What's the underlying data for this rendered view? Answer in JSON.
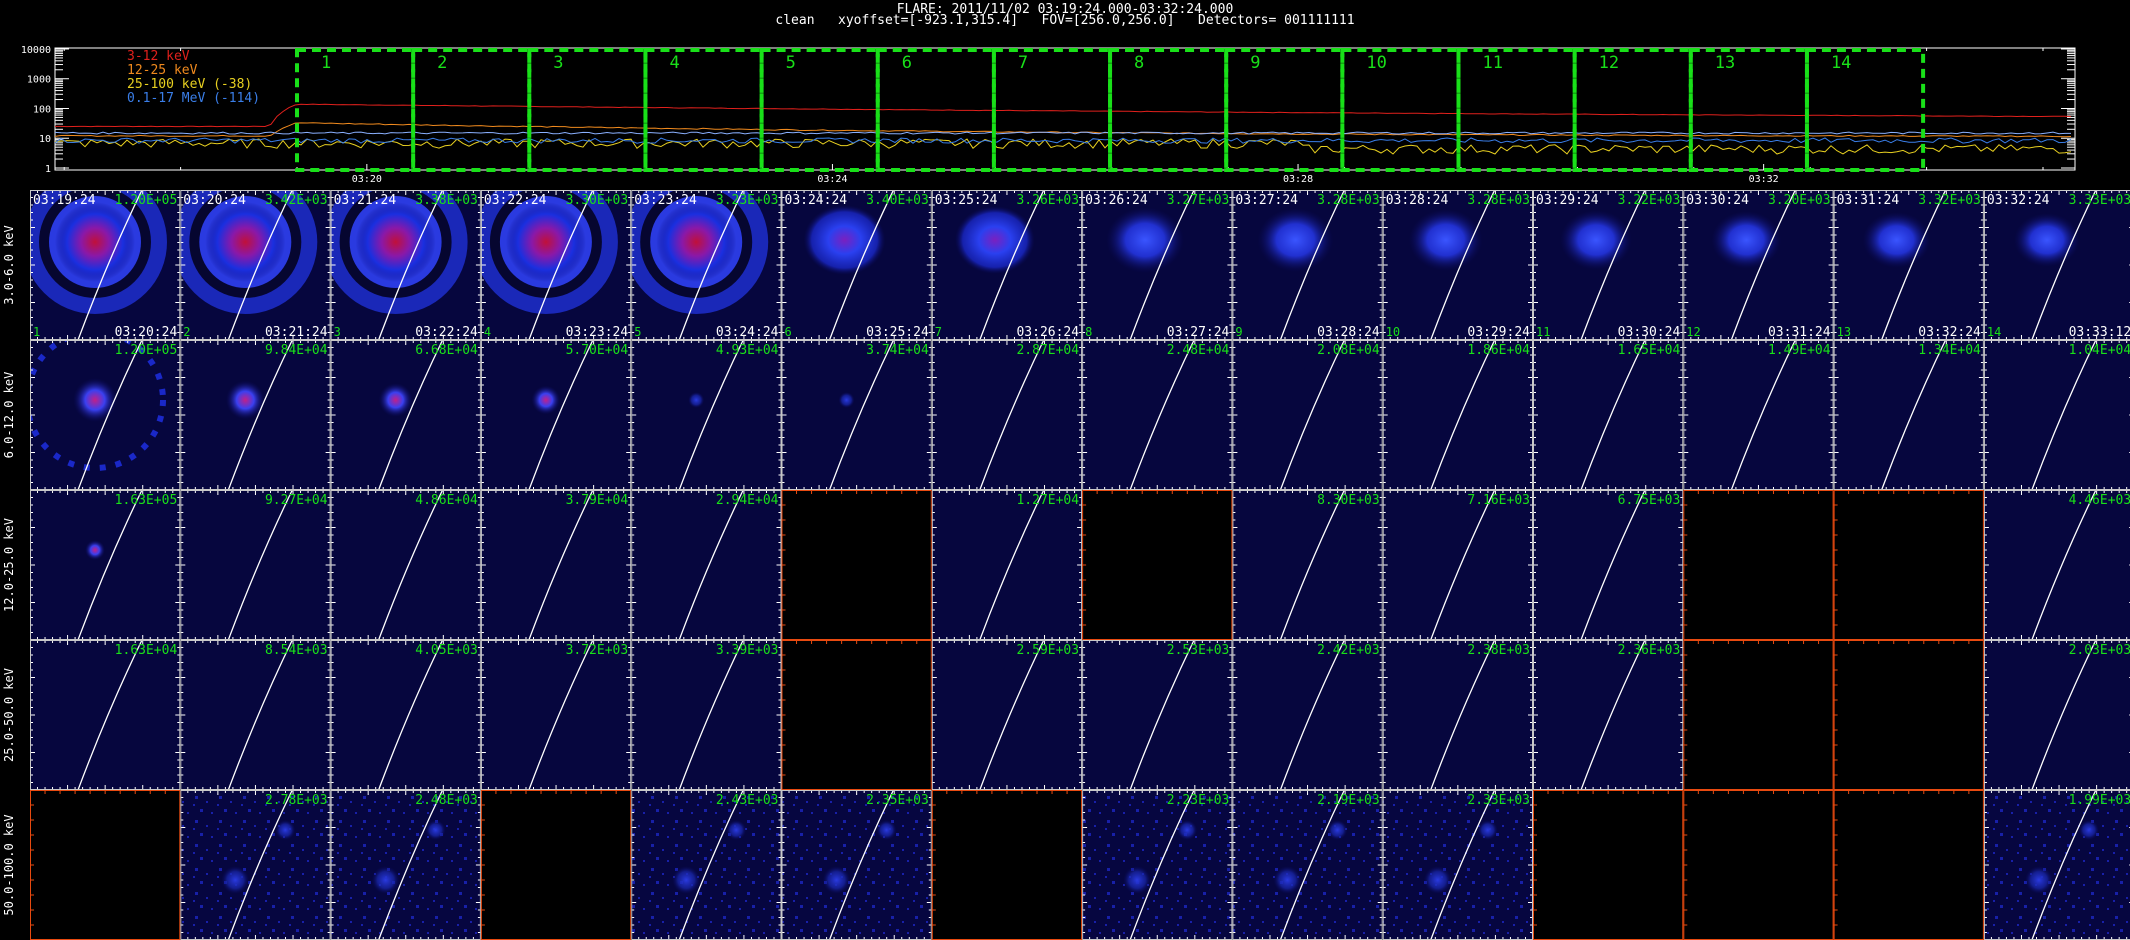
{
  "header": {
    "line1": "FLARE: 2011/11/02 03:19:24.000-03:32:24.000",
    "line2": "clean   xyoffset=[-923.1,315.4]   FOV=[256.0,256.0]   Detectors= 001111111"
  },
  "lightcurve": {
    "y_ticks": [
      "10000",
      "1000",
      "100",
      "10",
      "1"
    ],
    "x_ticks": [
      "03:20",
      "03:24",
      "03:28",
      "03:32"
    ],
    "legend": [
      {
        "text": "3-12 keV",
        "color": "#e0201c"
      },
      {
        "text": "12-25 keV",
        "color": "#f08a1e"
      },
      {
        "text": "25-100 keV (-38)",
        "color": "#e8d020"
      },
      {
        "text": "0.1-17 MeV (-114)",
        "color": "#3a7ee8"
      }
    ],
    "interval_labels": [
      "1",
      "2",
      "3",
      "4",
      "5",
      "6",
      "7",
      "8",
      "9",
      "10",
      "11",
      "12",
      "13",
      "14"
    ],
    "interval_color": "#19e019",
    "curve_colors": [
      "#e0201c",
      "#f08a1e",
      "#e8d020",
      "#3a7ee8",
      "#8ab0ff"
    ]
  },
  "grid": {
    "energy_bands": [
      "3.0-6.0 keV",
      "6.0-12.0 keV",
      "12.0-25.0 keV",
      "25.0-50.0 keV",
      "50.0-100.0 keV"
    ],
    "start_times": [
      "03:19:24",
      "03:20:24",
      "03:21:24",
      "03:22:24",
      "03:23:24",
      "03:24:24",
      "03:25:24",
      "03:26:24",
      "03:27:24",
      "03:28:24",
      "03:29:24",
      "03:30:24",
      "03:31:24",
      "03:32:24"
    ],
    "end_times": [
      "03:20:24",
      "03:21:24",
      "03:22:24",
      "03:23:24",
      "03:24:24",
      "03:25:24",
      "03:26:24",
      "03:27:24",
      "03:28:24",
      "03:29:24",
      "03:30:24",
      "03:31:24",
      "03:32:24",
      "03:33:12"
    ],
    "panel_numbers": [
      "1",
      "2",
      "3",
      "4",
      "5",
      "6",
      "7",
      "8",
      "9",
      "10",
      "11",
      "12",
      "13",
      "14"
    ],
    "values": [
      [
        "1.20E+05",
        "3.42E+03",
        "3.38E+03",
        "3.30E+03",
        "3.23E+03",
        "3.40E+03",
        "3.26E+03",
        "3.27E+03",
        "3.28E+03",
        "3.28E+03",
        "3.22E+03",
        "3.20E+03",
        "3.32E+03",
        "3.33E+03"
      ],
      [
        "1.20E+05",
        "9.84E+04",
        "6.68E+04",
        "5.70E+04",
        "4.93E+04",
        "3.74E+04",
        "2.87E+04",
        "2.48E+04",
        "2.08E+04",
        "1.86E+04",
        "1.65E+04",
        "1.49E+04",
        "1.34E+04",
        "1.04E+04"
      ],
      [
        "1.63E+05",
        "9.27E+04",
        "4.86E+04",
        "3.79E+04",
        "2.94E+04",
        "",
        "1.27E+04",
        "",
        "8.30E+03",
        "7.16E+03",
        "6.75E+03",
        "",
        "",
        "4.46E+03"
      ],
      [
        "1.63E+04",
        "8.54E+03",
        "4.05E+03",
        "3.72E+03",
        "3.39E+03",
        "",
        "2.59E+03",
        "2.53E+03",
        "2.42E+03",
        "2.38E+03",
        "2.36E+03",
        "",
        "",
        "2.03E+03"
      ],
      [
        "",
        "2.78E+03",
        "2.48E+03",
        "",
        "2.43E+03",
        "2.35E+03",
        "",
        "2.23E+03",
        "2.19E+03",
        "2.33E+03",
        "",
        "",
        "",
        "1.99E+03"
      ]
    ],
    "text_color": "#19e019",
    "time_color": "#ffffff",
    "empty_border_color": "#e84a10",
    "tick_color": "#ffffff",
    "limb_color": "#ffffff"
  }
}
